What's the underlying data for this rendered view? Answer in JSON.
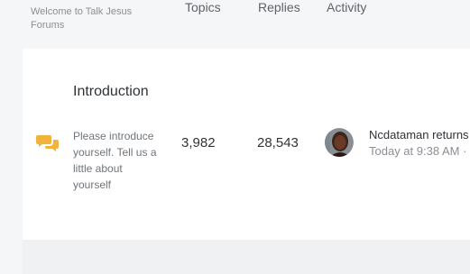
{
  "category": {
    "description": "Welcome to Talk Jesus Forums"
  },
  "columns": {
    "topics": "Topics",
    "replies": "Replies",
    "activity": "Activity"
  },
  "forum": {
    "icon": "chat-bubbles-icon",
    "icon_color": "#f2b33d",
    "title": "Introduction",
    "description": "Please introduce yourself. Tell us a little about yourself",
    "topics": "3,982",
    "replies": "28,543",
    "latest": {
      "user": "Ncdataman returns",
      "time": "Today at 9:38 AM ·"
    }
  }
}
